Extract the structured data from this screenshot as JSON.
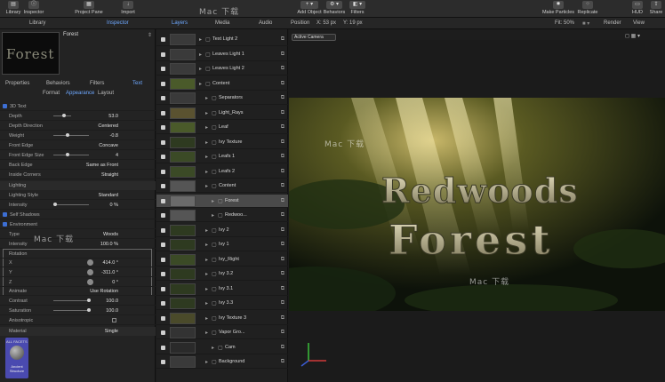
{
  "toolbar": {
    "library": "Library",
    "inspector": "Inspector",
    "project_pane": "Project Pane",
    "import": "Import",
    "add_object": "Add Object",
    "behaviors": "Behaviors",
    "filters": "Filters",
    "make_particles": "Make Particles",
    "replicate": "Replicate",
    "hud": "HUD",
    "share": "Share"
  },
  "panel_tabs": {
    "library": "Library",
    "inspector": "Inspector",
    "layers": "Layers",
    "media": "Media",
    "audio": "Audio"
  },
  "viewer": {
    "position_label": "Position",
    "pos_x": "X: 53 px",
    "pos_y": "Y: 19 px",
    "fit_label": "Fit: 50%",
    "render_label": "Render",
    "view_label": "View",
    "camera": "Active Camera"
  },
  "inspector": {
    "preview_title": "Forest",
    "tabs": [
      "Properties",
      "Behaviors",
      "Filters",
      "Text"
    ],
    "subtabs": [
      "Format",
      "Appearance",
      "Layout"
    ],
    "rows": [
      {
        "label": "3D Text",
        "value": ""
      },
      {
        "label": "Depth",
        "value": "53.0"
      },
      {
        "label": "Depth Direction",
        "value": "Centered"
      },
      {
        "label": "Weight",
        "value": "-0.8"
      },
      {
        "label": "Front Edge",
        "value": "Concave"
      },
      {
        "label": "Front Edge Size",
        "value": "4"
      },
      {
        "label": "Back Edge",
        "value": "Same as Front"
      },
      {
        "label": "Inside Corners",
        "value": "Straight"
      },
      {
        "label": "Lighting",
        "value": ""
      },
      {
        "label": "Lighting Style",
        "value": "Standard"
      },
      {
        "label": "Intensity",
        "value": "0 %"
      },
      {
        "label": "Self Shadows",
        "value": ""
      },
      {
        "label": "Environment",
        "value": ""
      },
      {
        "label": "Type",
        "value": "Woods"
      },
      {
        "label": "Intensity",
        "value": "100.0 %"
      },
      {
        "label": "Rotation",
        "value": ""
      },
      {
        "label": "X",
        "value": "414.0 °"
      },
      {
        "label": "Y",
        "value": "-311.0 °"
      },
      {
        "label": "Z",
        "value": "0 °"
      },
      {
        "label": "Animate",
        "value": "Use Rotation"
      },
      {
        "label": "Contrast",
        "value": "100.0"
      },
      {
        "label": "Saturation",
        "value": "100.0"
      },
      {
        "label": "Anisotropic",
        "value": ""
      },
      {
        "label": "Material",
        "value": "Single"
      }
    ],
    "material_label": "ALL FACETS",
    "material_name": "Ancient Structure"
  },
  "layers": [
    {
      "name": "Text Light 2",
      "indent": 0
    },
    {
      "name": "Leaves Light 1",
      "indent": 0
    },
    {
      "name": "Leaves Light 2",
      "indent": 0
    },
    {
      "name": "Content",
      "indent": 0
    },
    {
      "name": "Separators",
      "indent": 1
    },
    {
      "name": "Light_Rays",
      "indent": 1
    },
    {
      "name": "Leaf",
      "indent": 1
    },
    {
      "name": "Ivy Texture",
      "indent": 1
    },
    {
      "name": "Leafs 1",
      "indent": 1
    },
    {
      "name": "Leafs 2",
      "indent": 1
    },
    {
      "name": "Content",
      "indent": 1
    },
    {
      "name": "Forest",
      "indent": 2
    },
    {
      "name": "Redwoo...",
      "indent": 2
    },
    {
      "name": "Ivy 2",
      "indent": 1
    },
    {
      "name": "Ivy 1",
      "indent": 1
    },
    {
      "name": "Ivy_Right",
      "indent": 1
    },
    {
      "name": "Ivy 3.2",
      "indent": 1
    },
    {
      "name": "Ivy 3.1",
      "indent": 1
    },
    {
      "name": "Ivy 3.3",
      "indent": 1
    },
    {
      "name": "Ivy Texture 3",
      "indent": 1
    },
    {
      "name": "Vapor Gro...",
      "indent": 1
    },
    {
      "name": "Cam",
      "indent": 2
    },
    {
      "name": "Background",
      "indent": 1
    }
  ],
  "canvas": {
    "title_line1": "Redwoods",
    "title_line2": "Forest"
  },
  "watermark": "Mac 下载"
}
